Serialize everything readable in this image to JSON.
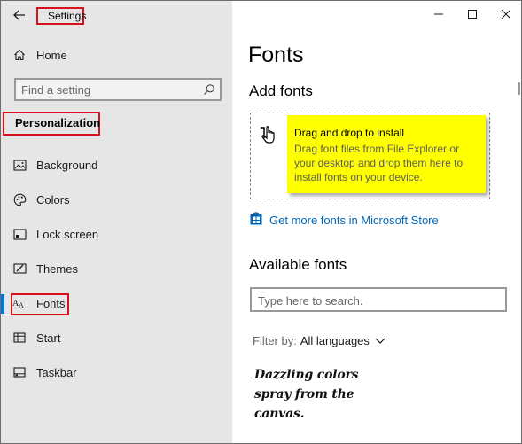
{
  "window": {
    "title": "Settings",
    "controls": {
      "minimize_icon": "minimize-icon",
      "maximize_icon": "maximize-icon",
      "close_icon": "close-icon"
    }
  },
  "sidebar": {
    "home_label": "Home",
    "search_placeholder": "Find a setting",
    "section_title": "Personalization",
    "items": [
      {
        "label": "Background",
        "icon": "picture-icon"
      },
      {
        "label": "Colors",
        "icon": "palette-icon"
      },
      {
        "label": "Lock screen",
        "icon": "lock-screen-icon"
      },
      {
        "label": "Themes",
        "icon": "brush-icon"
      },
      {
        "label": "Fonts",
        "icon": "fonts-icon",
        "selected": true
      },
      {
        "label": "Start",
        "icon": "start-icon"
      },
      {
        "label": "Taskbar",
        "icon": "taskbar-icon"
      }
    ]
  },
  "main": {
    "page_title": "Fonts",
    "add_fonts_heading": "Add fonts",
    "drop_zone": {
      "tooltip_title": "Drag and drop to install",
      "tooltip_body": "Drag font files from File Explorer or your desktop and drop them here to install fonts on your device."
    },
    "store_link": "Get more fonts in Microsoft Store",
    "available_fonts_heading": "Available fonts",
    "font_search_placeholder": "Type here to search.",
    "filter_label": "Filter by:",
    "filter_value": "All languages",
    "font_preview_text": "Dazzling colors spray from the canvas."
  },
  "colors": {
    "accent": "#0078d7",
    "link": "#0067b8",
    "annotation_red": "#d6121c",
    "tooltip_yellow": "#ffff00",
    "sidebar_bg": "#e6e6e6"
  }
}
